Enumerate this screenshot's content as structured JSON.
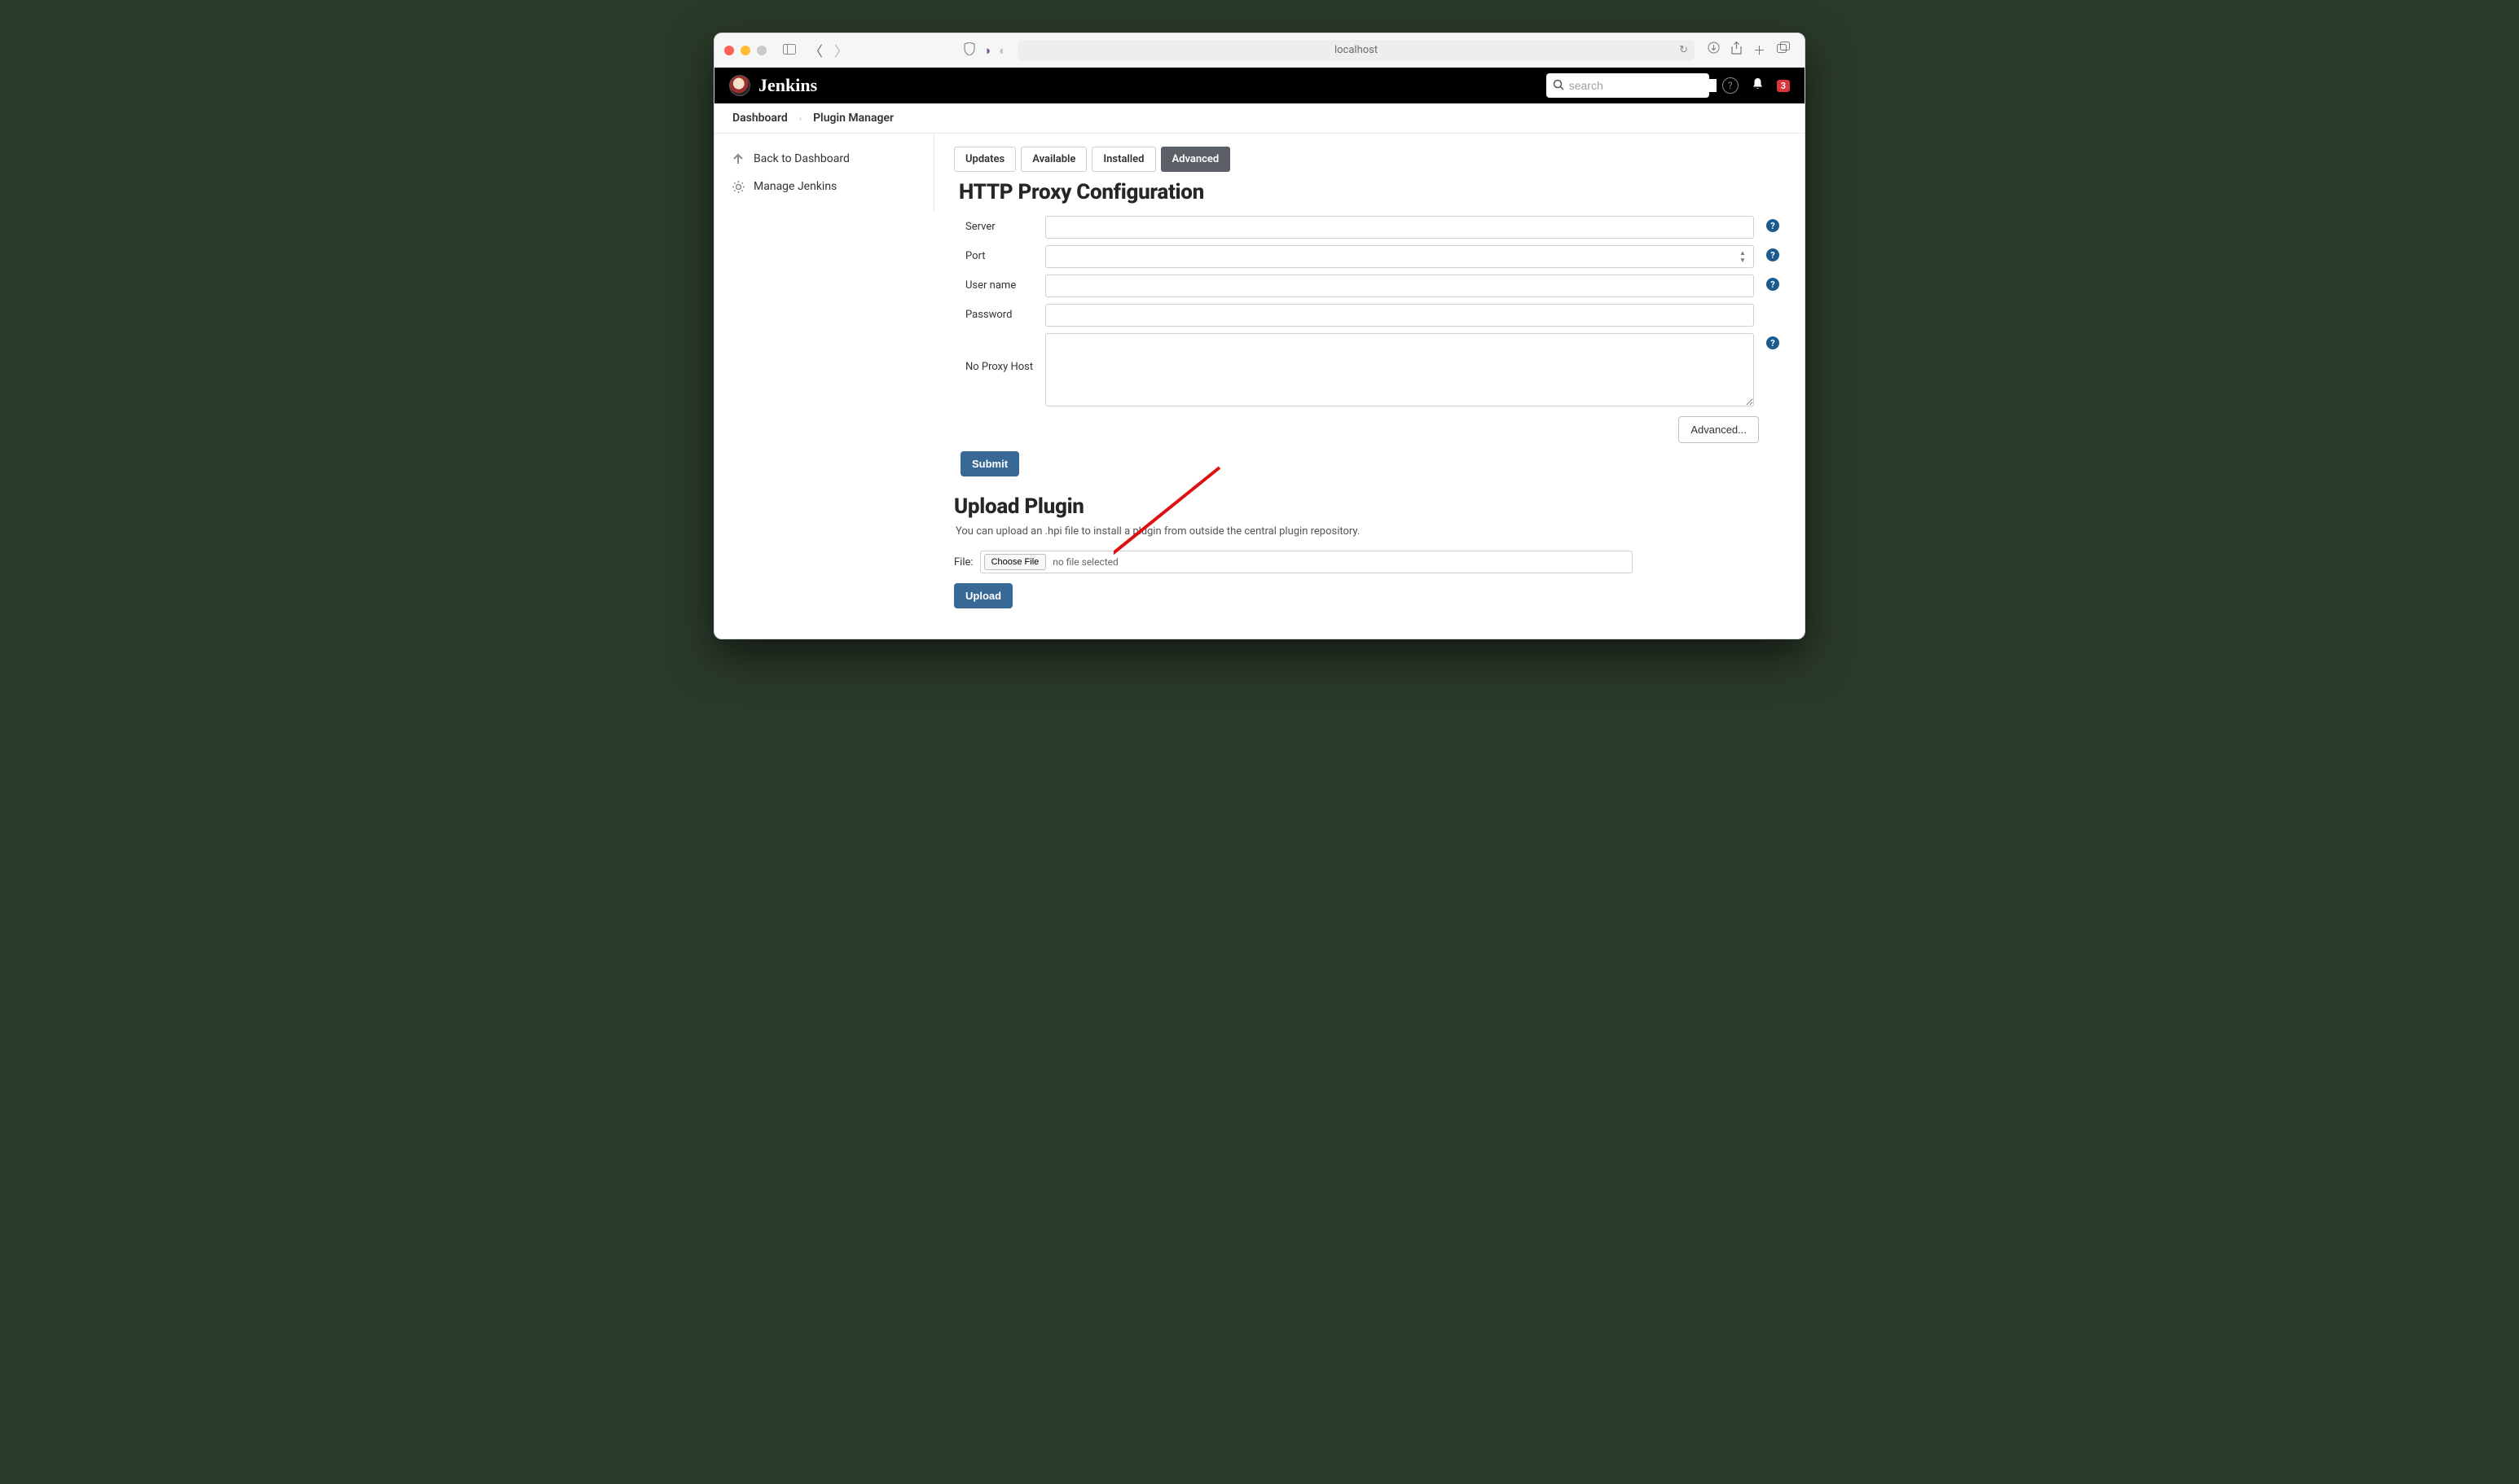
{
  "browser": {
    "url": "localhost"
  },
  "header": {
    "brand": "Jenkins",
    "search_placeholder": "search",
    "notif_count": "3"
  },
  "breadcrumbs": {
    "items": [
      "Dashboard",
      "Plugin Manager"
    ]
  },
  "sidebar": {
    "items": [
      {
        "label": "Back to Dashboard",
        "icon": "arrow-up"
      },
      {
        "label": "Manage Jenkins",
        "icon": "gear"
      }
    ]
  },
  "tabs": {
    "items": [
      "Updates",
      "Available",
      "Installed",
      "Advanced"
    ],
    "active": 3
  },
  "sections": {
    "proxy": {
      "title": "HTTP Proxy Configuration",
      "fields": {
        "server": {
          "label": "Server",
          "value": ""
        },
        "port": {
          "label": "Port",
          "value": ""
        },
        "username": {
          "label": "User name",
          "value": ""
        },
        "password": {
          "label": "Password",
          "value": ""
        },
        "noproxy": {
          "label": "No Proxy Host",
          "value": ""
        }
      },
      "advanced_btn": "Advanced...",
      "submit_btn": "Submit"
    },
    "upload": {
      "title": "Upload Plugin",
      "description": "You can upload an .hpi file to install a plugin from outside the central plugin repository.",
      "file_label": "File:",
      "choose_label": "Choose File",
      "file_status": "no file selected",
      "upload_btn": "Upload"
    }
  }
}
